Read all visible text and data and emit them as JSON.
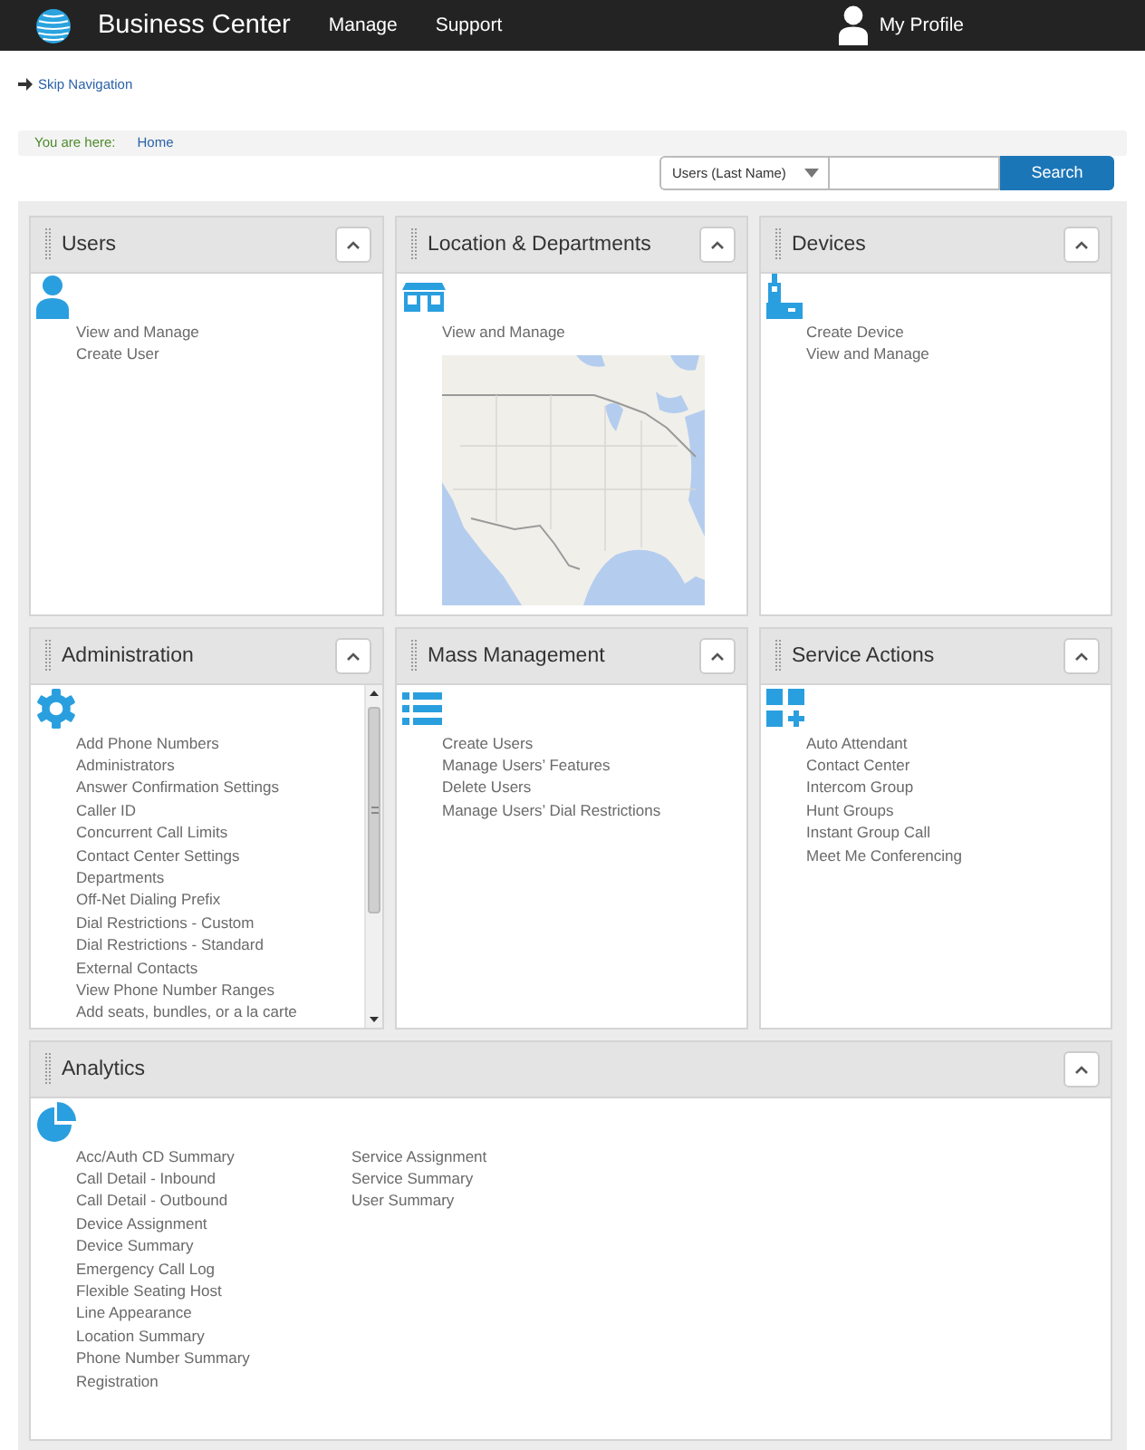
{
  "header": {
    "brand": "Business Center",
    "nav": [
      "Manage",
      "Support"
    ],
    "profile": "My Profile"
  },
  "skip_link": "Skip Navigation",
  "breadcrumb": {
    "label": "You are here:",
    "items": [
      "Home"
    ]
  },
  "search": {
    "category": "Users (Last Name)",
    "button": "Search"
  },
  "panels": [
    {
      "title": "Users",
      "kind": "users",
      "expanded": true,
      "columns": [
        [
          "View and Manage",
          "Create User"
        ]
      ]
    },
    {
      "title": "Location & Departments",
      "kind": "locations",
      "expanded": true,
      "columns": [
        [
          "View and Manage"
        ]
      ]
    },
    {
      "title": "Devices",
      "kind": "devices",
      "expanded": true,
      "columns": [
        [
          "Create Device",
          "View and Manage"
        ]
      ]
    },
    {
      "title": "Administration",
      "kind": "administration",
      "expanded": true,
      "columns": [
        [
          "Add Phone Numbers",
          "Administrators",
          "Answer Confirmation Settings",
          "Caller ID",
          "Concurrent Call Limits",
          "Contact Center Settings",
          "Departments",
          "Off-Net Dialing Prefix",
          "Dial Restrictions - Custom",
          "Dial Restrictions - Standard",
          "External Contacts",
          "View Phone Number Ranges",
          "Add seats, bundles, or a la carte"
        ]
      ]
    },
    {
      "title": "Mass Management",
      "kind": "mass_management",
      "expanded": true,
      "columns": [
        [
          "Create Users",
          "Manage Users’ Features",
          "Delete Users",
          "Manage Users’ Dial Restrictions"
        ]
      ]
    },
    {
      "title": "Service Actions",
      "kind": "service_actions",
      "expanded": true,
      "columns": [
        [
          "Auto Attendant",
          "Contact Center",
          "Intercom Group",
          "Hunt Groups",
          "Instant Group Call",
          "Meet Me Conferencing"
        ]
      ]
    },
    {
      "title": "Analytics",
      "kind": "analytics",
      "expanded": true,
      "columns": [
        [
          "Acc/Auth CD Summary",
          "Call Detail - Inbound",
          "Call Detail - Outbound",
          "Device Assignment",
          "Device Summary",
          "Emergency Call Log",
          "Flexible Seating Host",
          "Line Appearance",
          "Location Summary",
          "Phone Number Summary",
          "Registration"
        ],
        [
          "Service Assignment",
          "Service Summary",
          "User Summary"
        ]
      ]
    }
  ]
}
